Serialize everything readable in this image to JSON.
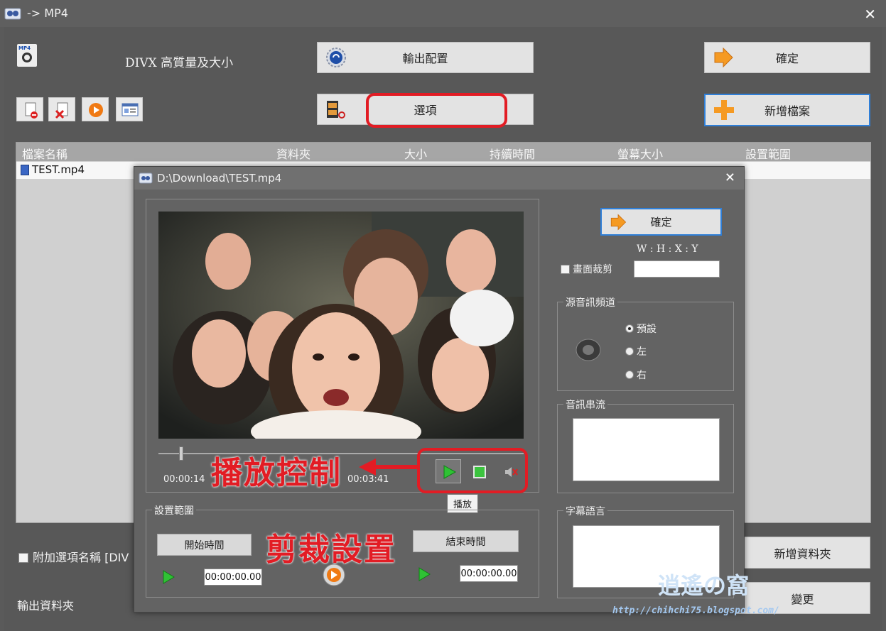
{
  "window": {
    "title": "-> MP4"
  },
  "profile": {
    "label": "DIVX 高質量及大小"
  },
  "buttons": {
    "output_config": "輸出配置",
    "ok": "確定",
    "options": "選項",
    "add_file": "新增檔案",
    "add_folder": "新增資料夾",
    "change": "變更"
  },
  "toolbar": {
    "icons": [
      "remove-file-icon",
      "clear-list-icon",
      "play-icon",
      "info-icon"
    ]
  },
  "filelist": {
    "columns": [
      "檔案名稱",
      "資料夾",
      "大小",
      "持續時間",
      "螢幕大小",
      "設置範圍"
    ],
    "rows": [
      {
        "name": "TEST.mp4"
      }
    ]
  },
  "addname_label": "附加選項名稱 [DIV",
  "output_folder_label": "輸出資料夾",
  "dialog": {
    "title": "D:\\Download\\TEST.mp4",
    "ok": "確定",
    "crop": {
      "label": "畫面裁剪",
      "format": "W : H : X : Y",
      "value": ""
    },
    "audio_channel": {
      "title": "源音訊頻道",
      "options": [
        "預設",
        "左",
        "右"
      ],
      "selected": "預設"
    },
    "audio_stream": {
      "title": "音訊串流"
    },
    "subtitle": {
      "title": "字幕語言"
    },
    "playback": {
      "current_time": "00:00:14",
      "total_time": "00:03:41",
      "position_fraction": 0.063,
      "tooltip": "播放"
    },
    "range": {
      "title": "設置範圍",
      "start_label": "開始時間",
      "end_label": "結束時間",
      "start_value": "00:00:00.00",
      "end_value": "00:00:00.00"
    }
  },
  "annotations": {
    "playback_control": "播放控制",
    "trim_settings": "剪裁設置"
  },
  "watermark": {
    "url": "http://chihchi75.blogspot.com/",
    "logo": "逍遙の窩"
  },
  "colors": {
    "annotation_red": "#e21c24",
    "focus_blue": "#2f7fd8"
  }
}
